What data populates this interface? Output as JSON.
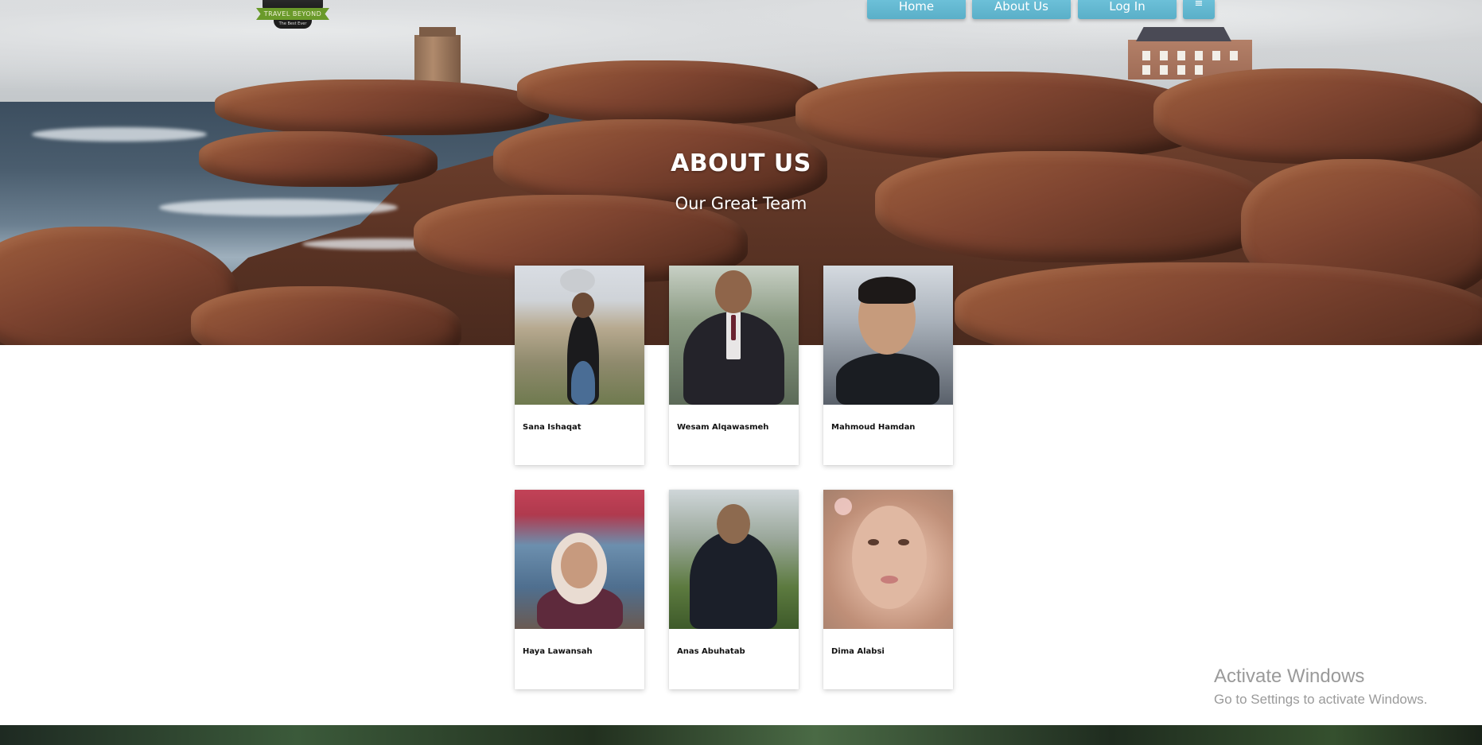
{
  "nav": {
    "logo_text": "TRAVEL BEYOND",
    "logo_tagline": "The Best Ever",
    "items": [
      {
        "label": "Home"
      },
      {
        "label": "About Us"
      },
      {
        "label": "Log In"
      }
    ],
    "menu_icon": "≡"
  },
  "hero": {
    "title": "ABOUT US",
    "subtitle": "Our Great Team"
  },
  "team": [
    {
      "name": "Sana Ishaqat"
    },
    {
      "name": "Wesam Alqawasmeh"
    },
    {
      "name": "Mahmoud Hamdan"
    },
    {
      "name": "Haya Lawansah"
    },
    {
      "name": "Anas Abuhatab"
    },
    {
      "name": "Dima Alabsi"
    }
  ],
  "watermark": {
    "title": "Activate Windows",
    "subtitle": "Go to Settings to activate Windows."
  },
  "colors": {
    "nav_button": "#5aafc8",
    "hero_text": "#ffffff",
    "card_bg": "#ffffff"
  }
}
